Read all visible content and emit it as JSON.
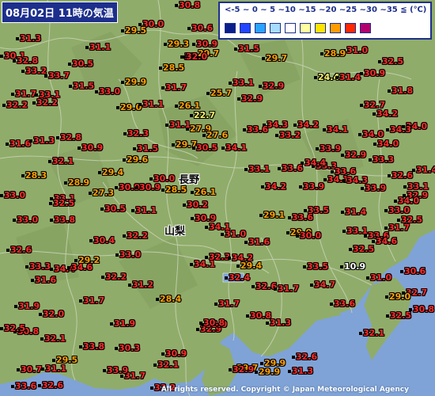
{
  "title": "08月02日 11時の気温",
  "legend": {
    "ranges_label": "<-5 ~ 0 ~ 5 ~10 ~15 ~20 ~25 ~30 ~35 ≦ (℃)",
    "colors": [
      "#0a1f8c",
      "#2146ff",
      "#29a3ff",
      "#a6dcff",
      "#ffffff",
      "#ffff9e",
      "#ffe400",
      "#ff9c00",
      "#ff2800",
      "#b4006e"
    ]
  },
  "prefectures": {
    "nagano": "長野",
    "yamanashi": "山梨"
  },
  "copyright": "All rights reserved. Copyright © Japan Meteorological Agency",
  "stations": [
    {
      "v": "30.8",
      "c": "r"
    },
    {
      "v": "30.0",
      "c": "r"
    },
    {
      "v": "29.5",
      "c": "o"
    },
    {
      "v": "30.6",
      "c": "r"
    },
    {
      "v": "29.3",
      "c": "o"
    },
    {
      "v": "30.9",
      "c": "r"
    },
    {
      "v": "31.3",
      "c": "r"
    },
    {
      "v": "32.0",
      "c": "r"
    },
    {
      "v": "31.1",
      "c": "r"
    },
    {
      "v": "29.7",
      "c": "o"
    },
    {
      "v": "31.5",
      "c": "r"
    },
    {
      "v": "29.7",
      "c": "o"
    },
    {
      "v": "31.0",
      "c": "r"
    },
    {
      "v": "28.9",
      "c": "o"
    },
    {
      "v": "32.5",
      "c": "r"
    },
    {
      "v": "30.1",
      "c": "r"
    },
    {
      "v": "32.8",
      "c": "r"
    },
    {
      "v": "30.5",
      "c": "r"
    },
    {
      "v": "28.5",
      "c": "o"
    },
    {
      "v": "32.0",
      "c": "r"
    },
    {
      "v": "33.2",
      "c": "r"
    },
    {
      "v": "33.7",
      "c": "r"
    },
    {
      "v": "24.4",
      "c": "y"
    },
    {
      "v": "31.4",
      "c": "r"
    },
    {
      "v": "30.9",
      "c": "r"
    },
    {
      "v": "33.1",
      "c": "r"
    },
    {
      "v": "29.9",
      "c": "o"
    },
    {
      "v": "31.5",
      "c": "r"
    },
    {
      "v": "32.9",
      "c": "r"
    },
    {
      "v": "33.0",
      "c": "r"
    },
    {
      "v": "31.7",
      "c": "r"
    },
    {
      "v": "31.7",
      "c": "r"
    },
    {
      "v": "31.8",
      "c": "r"
    },
    {
      "v": "33.1",
      "c": "r"
    },
    {
      "v": "32.9",
      "c": "r"
    },
    {
      "v": "25.7",
      "c": "o"
    },
    {
      "v": "32.7",
      "c": "r"
    },
    {
      "v": "32.2",
      "c": "r"
    },
    {
      "v": "32.2",
      "c": "r"
    },
    {
      "v": "29.0",
      "c": "o"
    },
    {
      "v": "31.1",
      "c": "r"
    },
    {
      "v": "26.1",
      "c": "o"
    },
    {
      "v": "34.2",
      "c": "r"
    },
    {
      "v": "22.7",
      "c": "y"
    },
    {
      "v": "31.1",
      "c": "r"
    },
    {
      "v": "27.9",
      "c": "o"
    },
    {
      "v": "34.3",
      "c": "r"
    },
    {
      "v": "34.2",
      "c": "r"
    },
    {
      "v": "33.6",
      "c": "r"
    },
    {
      "v": "34.1",
      "c": "r"
    },
    {
      "v": "34.0",
      "c": "r"
    },
    {
      "v": "34.0",
      "c": "r"
    },
    {
      "v": "31.6",
      "c": "r"
    },
    {
      "v": "31.3",
      "c": "r"
    },
    {
      "v": "32.8",
      "c": "r"
    },
    {
      "v": "32.3",
      "c": "r"
    },
    {
      "v": "27.6",
      "c": "o"
    },
    {
      "v": "33.2",
      "c": "r"
    },
    {
      "v": "34.3",
      "c": "r"
    },
    {
      "v": "34.0",
      "c": "r"
    },
    {
      "v": "30.9",
      "c": "r"
    },
    {
      "v": "31.5",
      "c": "r"
    },
    {
      "v": "29.7",
      "c": "o"
    },
    {
      "v": "30.5",
      "c": "r"
    },
    {
      "v": "34.1",
      "c": "r"
    },
    {
      "v": "33.9",
      "c": "r"
    },
    {
      "v": "32.9",
      "c": "r"
    },
    {
      "v": "33.3",
      "c": "r"
    },
    {
      "v": "33.3",
      "c": "r"
    },
    {
      "v": "32.1",
      "c": "r"
    },
    {
      "v": "29.6",
      "c": "o"
    },
    {
      "v": "34.4",
      "c": "r"
    },
    {
      "v": "33.1",
      "c": "r"
    },
    {
      "v": "33.6",
      "c": "r"
    },
    {
      "v": "33.6",
      "c": "r"
    },
    {
      "v": "32.6",
      "c": "r"
    },
    {
      "v": "28.3",
      "c": "o"
    },
    {
      "v": "29.4",
      "c": "o"
    },
    {
      "v": "30.0",
      "c": "r"
    },
    {
      "v": "31.4",
      "c": "r"
    },
    {
      "v": "28.9",
      "c": "o"
    },
    {
      "v": "34.2",
      "c": "r"
    },
    {
      "v": "33.9",
      "c": "r"
    },
    {
      "v": "33.1",
      "c": "r"
    },
    {
      "v": "27.3",
      "c": "o"
    },
    {
      "v": "30.9",
      "c": "r"
    },
    {
      "v": "30.9",
      "c": "r"
    },
    {
      "v": "28.5",
      "c": "o"
    },
    {
      "v": "34.1",
      "c": "r"
    },
    {
      "v": "34.3",
      "c": "r"
    },
    {
      "v": "33.9",
      "c": "r"
    },
    {
      "v": "26.1",
      "c": "o"
    },
    {
      "v": "33.0",
      "c": "r"
    },
    {
      "v": "32.9",
      "c": "r"
    },
    {
      "v": "30.2",
      "c": "r"
    },
    {
      "v": "34.0",
      "c": "r"
    },
    {
      "v": "30.5",
      "c": "r"
    },
    {
      "v": "31.1",
      "c": "r"
    },
    {
      "v": "29.1",
      "c": "o"
    },
    {
      "v": "33.6",
      "c": "r"
    },
    {
      "v": "30.9",
      "c": "r"
    },
    {
      "v": "33.0",
      "c": "r"
    },
    {
      "v": "33.1",
      "c": "r"
    },
    {
      "v": "32.5",
      "c": "r"
    },
    {
      "v": "33.5",
      "c": "r"
    },
    {
      "v": "33.0",
      "c": "r"
    },
    {
      "v": "33.8",
      "c": "r"
    },
    {
      "v": "34.1",
      "c": "r"
    },
    {
      "v": "29.0",
      "c": "o"
    },
    {
      "v": "31.7",
      "c": "r"
    },
    {
      "v": "32.5",
      "c": "r"
    },
    {
      "v": "31.4",
      "c": "r"
    },
    {
      "v": "32.2",
      "c": "r"
    },
    {
      "v": "31.0",
      "c": "r"
    },
    {
      "v": "33.1",
      "c": "r"
    },
    {
      "v": "33.6",
      "c": "r"
    },
    {
      "v": "34.6",
      "c": "r"
    },
    {
      "v": "30.4",
      "c": "r"
    },
    {
      "v": "31.6",
      "c": "r"
    },
    {
      "v": "30.0",
      "c": "r"
    },
    {
      "v": "32.6",
      "c": "r"
    },
    {
      "v": "33.0",
      "c": "r"
    },
    {
      "v": "32.3",
      "c": "r"
    },
    {
      "v": "34.2",
      "c": "r"
    },
    {
      "v": "32.5",
      "c": "r"
    },
    {
      "v": "29.2",
      "c": "o"
    },
    {
      "v": "34.4",
      "c": "r"
    },
    {
      "v": "33.3",
      "c": "r"
    },
    {
      "v": "34.6",
      "c": "r"
    },
    {
      "v": "29.4",
      "c": "o"
    },
    {
      "v": "33.5",
      "c": "r"
    },
    {
      "v": "10.9",
      "c": "w"
    },
    {
      "v": "31.6",
      "c": "r"
    },
    {
      "v": "32.2",
      "c": "r"
    },
    {
      "v": "34.1",
      "c": "r"
    },
    {
      "v": "32.4",
      "c": "r"
    },
    {
      "v": "31.0",
      "c": "r"
    },
    {
      "v": "30.6",
      "c": "r"
    },
    {
      "v": "32.7",
      "c": "r"
    },
    {
      "v": "31.2",
      "c": "r"
    },
    {
      "v": "32.6",
      "c": "r"
    },
    {
      "v": "34.7",
      "c": "r"
    },
    {
      "v": "31.7",
      "c": "r"
    },
    {
      "v": "29.0",
      "c": "o"
    },
    {
      "v": "31.9",
      "c": "r"
    },
    {
      "v": "32.0",
      "c": "r"
    },
    {
      "v": "31.7",
      "c": "r"
    },
    {
      "v": "28.4",
      "c": "o"
    },
    {
      "v": "31.7",
      "c": "r"
    },
    {
      "v": "33.6",
      "c": "r"
    },
    {
      "v": "32.5",
      "c": "r"
    },
    {
      "v": "30.8",
      "c": "r"
    },
    {
      "v": "32.9",
      "c": "r"
    },
    {
      "v": "30.8",
      "c": "r"
    },
    {
      "v": "31.9",
      "c": "r"
    },
    {
      "v": "33.0",
      "c": "r"
    },
    {
      "v": "30.8",
      "c": "r"
    },
    {
      "v": "31.3",
      "c": "r"
    },
    {
      "v": "32.5",
      "c": "r"
    },
    {
      "v": "32.1",
      "c": "r"
    },
    {
      "v": "30.8",
      "c": "r"
    },
    {
      "v": "32.1",
      "c": "r"
    },
    {
      "v": "30.3",
      "c": "r"
    },
    {
      "v": "33.5",
      "c": "r"
    },
    {
      "v": "30.9",
      "c": "r"
    },
    {
      "v": "29.5",
      "c": "o"
    },
    {
      "v": "32.1",
      "c": "r"
    },
    {
      "v": "32.6",
      "c": "r"
    },
    {
      "v": "29.9",
      "c": "o"
    },
    {
      "v": "31.1",
      "c": "r"
    },
    {
      "v": "33.8",
      "c": "r"
    },
    {
      "v": "30.7",
      "c": "r"
    },
    {
      "v": "31.7",
      "c": "r"
    },
    {
      "v": "29.7",
      "c": "o"
    },
    {
      "v": "33.9",
      "c": "r"
    },
    {
      "v": "32.9",
      "c": "r"
    },
    {
      "v": "32.6",
      "c": "r"
    },
    {
      "v": "33.2",
      "c": "r"
    },
    {
      "v": "33.6",
      "c": "r"
    },
    {
      "v": "29.9",
      "c": "o"
    },
    {
      "v": "31.3",
      "c": "r"
    }
  ]
}
